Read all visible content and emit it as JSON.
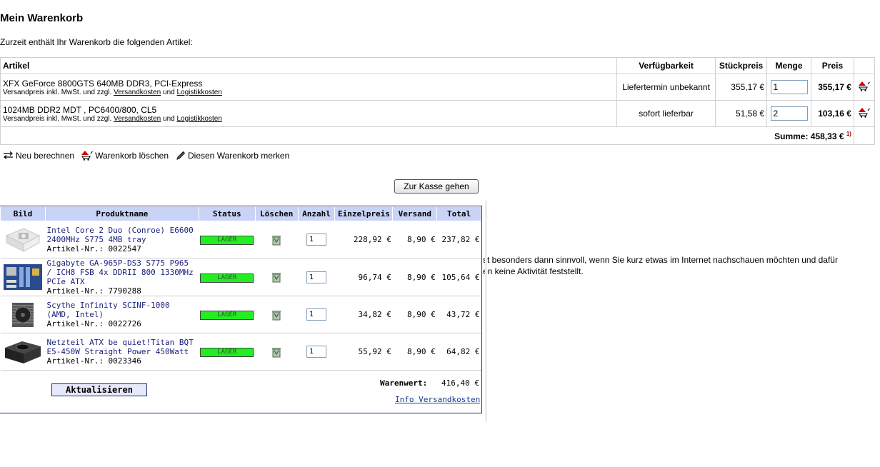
{
  "page": {
    "title": "Mein Warenkorb",
    "intro": "Zurzeit enthält Ihr Warenkorb die folgenden Artikel:"
  },
  "cart": {
    "headers": {
      "artikel": "Artikel",
      "verfuegbarkeit": "Verfügbarkeit",
      "stueckpreis": "Stückpreis",
      "menge": "Menge",
      "preis": "Preis"
    },
    "items": [
      {
        "name": "XFX GeForce 8800GTS 640MB DDR3, PCI-Express",
        "sub_prefix": "Versandpreis inkl. MwSt. und zzgl.",
        "link1": "Versandkosten",
        "und": "und",
        "link2": "Logistikkosten",
        "availability": "Liefertermin unbekannt",
        "unit_price": "355,17 €",
        "quantity": "1",
        "price": "355,17 €"
      },
      {
        "name": "1024MB DDR2 MDT , PC6400/800, CL5",
        "sub_prefix": "Versandpreis inkl. MwSt. und zzgl.",
        "link1": "Versandkosten",
        "und": "und",
        "link2": "Logistikkosten",
        "availability": "sofort lieferbar",
        "unit_price": "51,58 €",
        "quantity": "2",
        "price": "103,16 €"
      }
    ],
    "sum_label": "Summe: 458,33 €",
    "sum_note": "1)"
  },
  "actions": {
    "recalc": "Neu berechnen",
    "clear": "Warenkorb löschen",
    "remember": "Diesen Warenkorb merken"
  },
  "checkout_label": "Zur Kasse gehen",
  "background_text": {
    "line1": "st besonders dann sinnvoll, wenn Sie kurz etwas im Internet nachschauen möchten und dafür",
    "line2": "en keine Aktivität feststellt."
  },
  "panel": {
    "headers": {
      "bild": "Bild",
      "produktname": "Produktname",
      "status": "Status",
      "loeschen": "Löschen",
      "anzahl": "Anzahl",
      "einzelpreis": "Einzelpreis",
      "versand": "Versand",
      "total": "Total"
    },
    "items": [
      {
        "name": "Intel Core 2 Duo (Conroe) E6600 2400MHz S775 4MB tray",
        "artnr": "Artikel-Nr.: 0022547",
        "status": "LAGER",
        "qty": "1",
        "unit": "228,92 €",
        "shipping": "8,90 €",
        "total": "237,82 €",
        "thumb_icon": "no-image-placeholder-icon"
      },
      {
        "name": "Gigabyte GA-965P-DS3 S775 P965 / ICH8 FSB 4x DDRII 800 1330MHz PCIe ATX",
        "artnr": "Artikel-Nr.: 7790288",
        "status": "LAGER",
        "qty": "1",
        "unit": "96,74 €",
        "shipping": "8,90 €",
        "total": "105,64 €",
        "thumb_icon": "mainboard-icon"
      },
      {
        "name": "Scythe Infinity SCINF-1000 (AMD, Intel)",
        "artnr": "Artikel-Nr.: 0022726",
        "status": "LAGER",
        "qty": "1",
        "unit": "34,82 €",
        "shipping": "8,90 €",
        "total": "43,72 €",
        "thumb_icon": "cpu-cooler-icon"
      },
      {
        "name": "Netzteil ATX be quiet!Titan BQT E5-450W Straight Power 450Watt",
        "artnr": "Artikel-Nr.: 0023346",
        "status": "LAGER",
        "qty": "1",
        "unit": "55,92 €",
        "shipping": "8,90 €",
        "total": "64,82 €",
        "thumb_icon": "power-supply-icon"
      }
    ],
    "warenwert_label": "Warenwert:",
    "warenwert_value": "416,40 €",
    "update_label": "Aktualisieren",
    "info_link": "Info Versandkosten"
  },
  "colors": {
    "panel_border": "#1a2f72",
    "panel_header_bg": "#c9d3f5",
    "lager_green": "#22ee22",
    "delete_red": "#cc0000"
  }
}
